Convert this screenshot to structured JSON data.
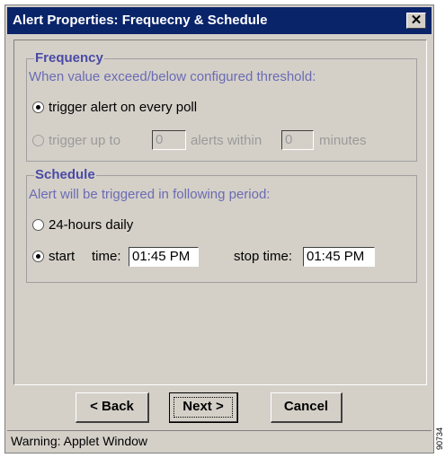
{
  "window": {
    "title": "Alert Properties: Frequecny & Schedule",
    "close_symbol": "✕"
  },
  "frequency": {
    "legend": "Frequency",
    "description": "When value exceed/below configured threshold:",
    "option_every_poll": "trigger alert on every poll",
    "option_up_to_prefix": "trigger up to",
    "alerts_value": "0",
    "alerts_within_label": "alerts within",
    "minutes_value": "0",
    "minutes_label": "minutes",
    "selected": "every_poll"
  },
  "schedule": {
    "legend": "Schedule",
    "description": "Alert will be triggered in following period:",
    "option_daily": "24-hours daily",
    "start_label": "start",
    "time_label": "time:",
    "start_time": "01:45 PM",
    "stop_label": "stop time:",
    "stop_time": "01:45 PM",
    "selected": "start_time"
  },
  "buttons": {
    "back": "< Back",
    "next": "Next >",
    "cancel": "Cancel"
  },
  "status_bar": {
    "text": "Warning: Applet Window"
  },
  "side_label": "90734"
}
